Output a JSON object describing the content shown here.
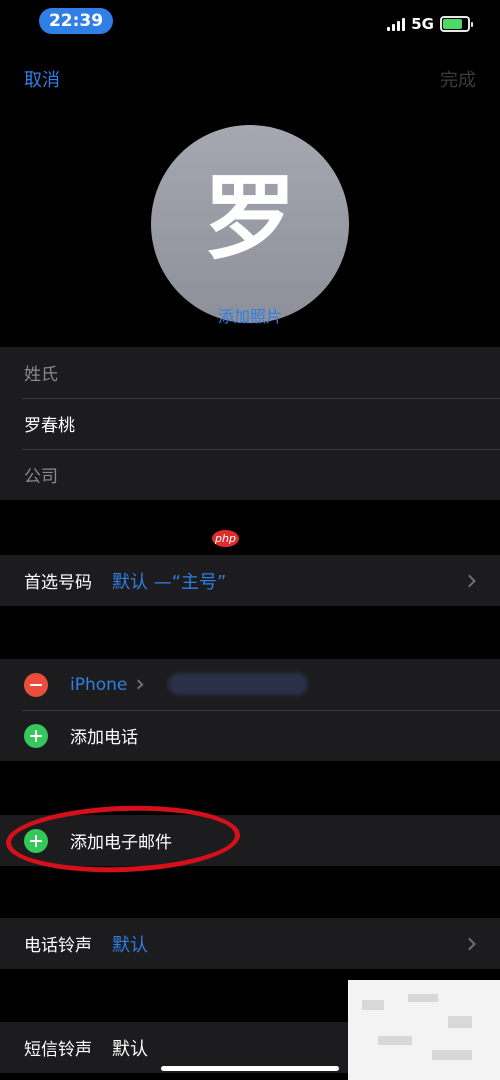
{
  "status_bar": {
    "time": "22:39",
    "network": "5G",
    "battery_level": 0.8
  },
  "nav": {
    "cancel": "取消",
    "done": "完成"
  },
  "avatar": {
    "initial": "罗",
    "add_photo": "添加照片"
  },
  "name_fields": {
    "last_name_placeholder": "姓氏",
    "first_name_value": "罗春桃",
    "company_placeholder": "公司"
  },
  "preferred_number": {
    "label": "首选号码",
    "value": "默认 —“主号”"
  },
  "phones": {
    "existing_label": "iPhone",
    "add_phone": "添加电话"
  },
  "email": {
    "add_email": "添加电子邮件"
  },
  "ringtone": {
    "label": "电话铃声",
    "value": "默认"
  },
  "text_tone": {
    "label": "短信铃声",
    "value": "默认"
  },
  "watermark": {
    "text": "php"
  },
  "colors": {
    "accent": "#2f7fe6",
    "delete": "#eb4d3d",
    "add": "#34c759",
    "annotation": "#d6101b"
  }
}
